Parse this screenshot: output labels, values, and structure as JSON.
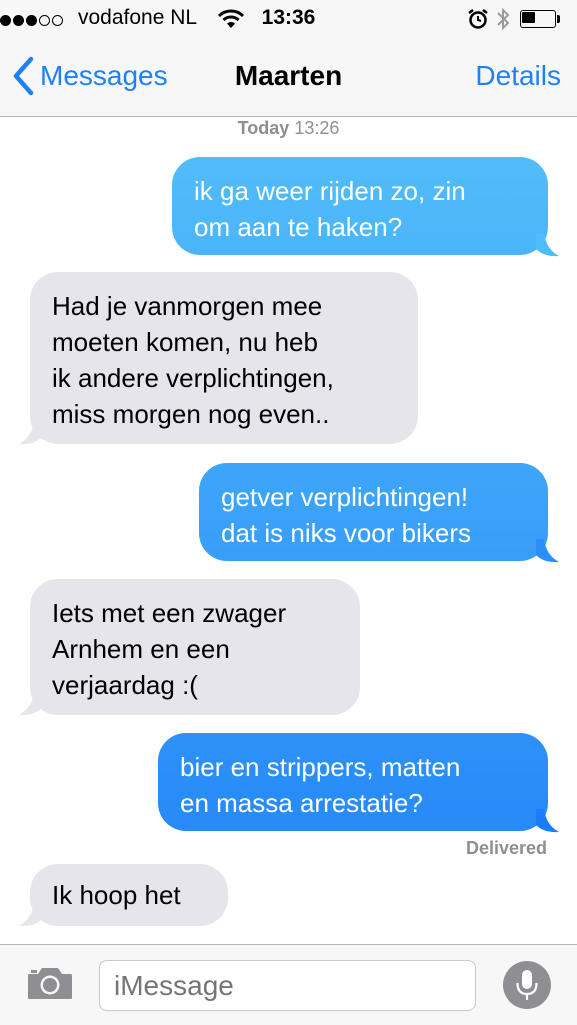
{
  "status_bar": {
    "signal_bars_filled": 3,
    "signal_bars_total": 5,
    "carrier": "vodafone NL",
    "time": "13:36",
    "battery_level": 0.4,
    "icons": [
      "wifi-icon",
      "alarm-icon",
      "bluetooth-icon",
      "battery-icon"
    ]
  },
  "nav": {
    "back_label": "Messages",
    "title": "Maarten",
    "details_label": "Details"
  },
  "thread": {
    "timestamp_day": "Today",
    "timestamp_time": "13:26",
    "messages": [
      {
        "direction": "outgoing",
        "text": "ik ga weer rijden zo, zin\nom aan te haken?"
      },
      {
        "direction": "incoming",
        "text": "Had je vanmorgen mee\nmoeten komen, nu heb\nik andere verplichtingen,\nmiss morgen nog even.."
      },
      {
        "direction": "outgoing",
        "text": "getver verplichtingen!\ndat is niks voor bikers"
      },
      {
        "direction": "incoming",
        "text": "Iets met een zwager\nArnhem en een\nverjaardag :("
      },
      {
        "direction": "outgoing",
        "text": "bier en strippers, matten\nen massa arrestatie?"
      },
      {
        "direction": "incoming",
        "text": "Ik hoop het"
      }
    ],
    "delivered_label": "Delivered"
  },
  "input": {
    "placeholder": "iMessage"
  },
  "colors": {
    "accent": "#1a82fb",
    "outgoing_bubble_top": "#5ac8fa",
    "outgoing_bubble_bottom": "#1a7cf8",
    "incoming_bubble": "#e6e5eb",
    "meta_text": "#8e8e93"
  }
}
